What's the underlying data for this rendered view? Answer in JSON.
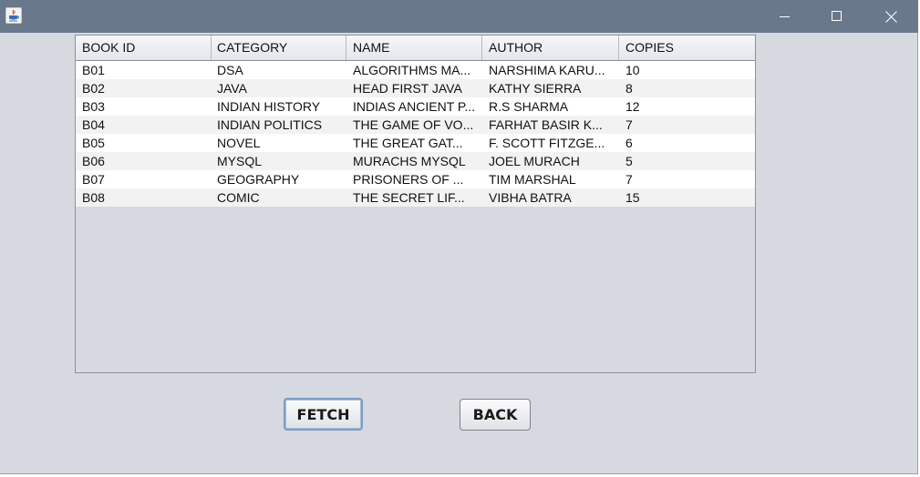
{
  "window": {
    "controls": {
      "minimize": "minimize-icon",
      "maximize": "maximize-icon",
      "close": "close-icon"
    },
    "title_bar_color": "#6a788c",
    "background_color": "#d6d9e0"
  },
  "table": {
    "columns": [
      "BOOK ID",
      "CATEGORY",
      "NAME",
      "AUTHOR",
      "COPIES"
    ],
    "rows": [
      [
        "B01",
        "DSA",
        "ALGORITHMS MA...",
        "NARSHIMA KARU...",
        "10"
      ],
      [
        "B02",
        "JAVA",
        "HEAD FIRST JAVA",
        "KATHY SIERRA",
        "8"
      ],
      [
        "B03",
        "INDIAN HISTORY",
        "INDIAS ANCIENT P...",
        "R.S SHARMA",
        "12"
      ],
      [
        "B04",
        "INDIAN POLITICS",
        "THE GAME OF VO...",
        "FARHAT BASIR K...",
        "7"
      ],
      [
        "B05",
        "NOVEL",
        "THE GREAT GAT...",
        "F. SCOTT FITZGE...",
        "6"
      ],
      [
        "B06",
        "MYSQL",
        "MURACHS MYSQL",
        "JOEL MURACH",
        "5"
      ],
      [
        "B07",
        "GEOGRAPHY",
        "PRISONERS OF ...",
        "TIM MARSHAL",
        "7"
      ],
      [
        "B08",
        "COMIC",
        "THE SECRET LIF...",
        "VIBHA BATRA",
        "15"
      ]
    ]
  },
  "buttons": {
    "fetch": "FETCH",
    "back": "BACK"
  }
}
